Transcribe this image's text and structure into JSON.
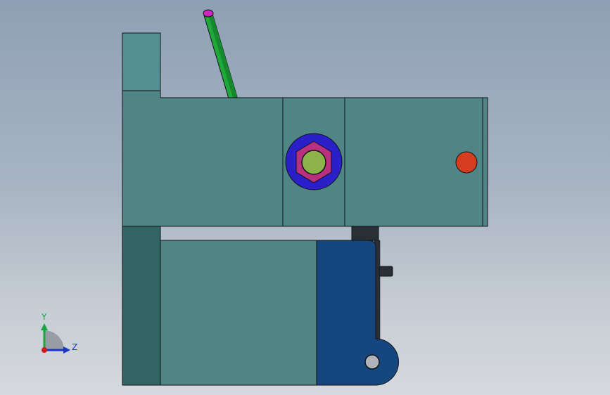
{
  "axis_triad": {
    "y_label": "Y",
    "z_label": "Z"
  },
  "colors": {
    "body": "#4f8585",
    "body_top_block": "#569090",
    "side_dark": "#336464",
    "clamp_blue": "#15477e",
    "washer_blue": "#2a1fc8",
    "nut_magenta": "#b8307e",
    "bolt_green": "#8cb24a",
    "pin_red": "#d43d1d",
    "lever_green": "#21a83a",
    "lever_tip": "#d023c0",
    "bracket_dark": "#2a2f36",
    "pivot_gray": "#b0b4ba",
    "outline": "#101418",
    "axis_y": "#16a83a",
    "axis_z": "#1a35c8",
    "axis_origin": "#d01a1a"
  }
}
